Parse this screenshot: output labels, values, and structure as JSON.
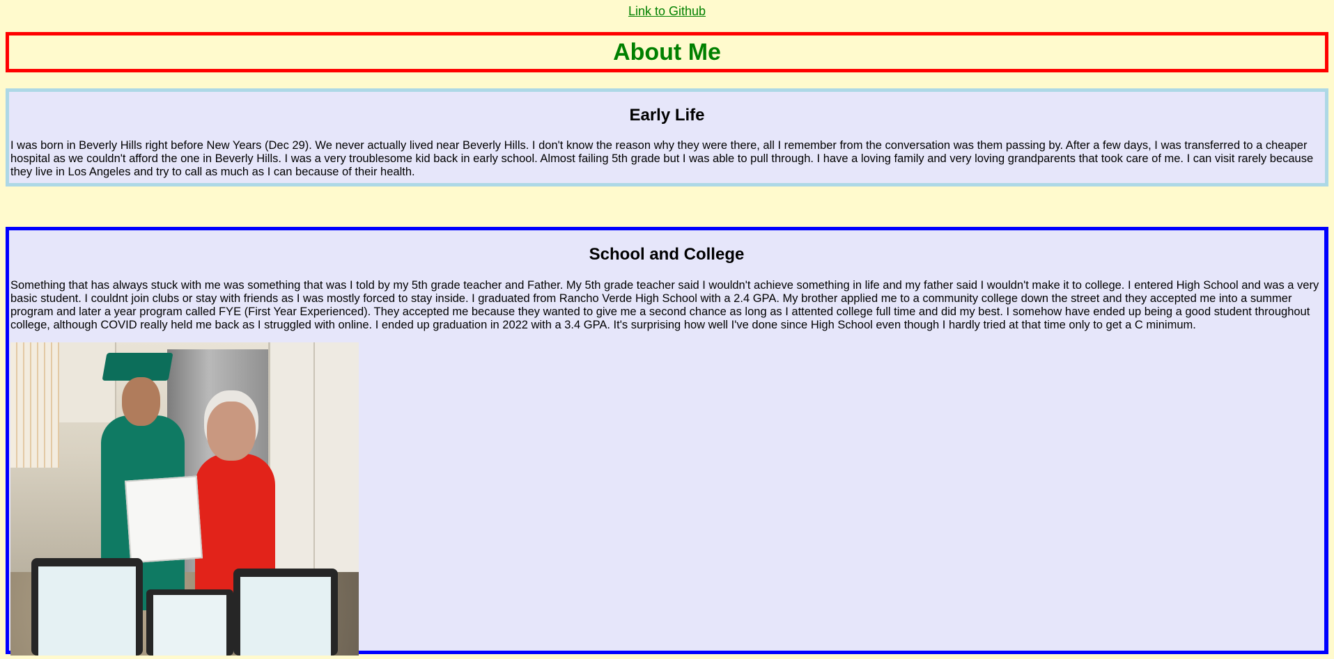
{
  "header": {
    "github_link": "Link to Github",
    "title": "About Me"
  },
  "early_life": {
    "heading": "Early Life",
    "text": "I was born in Beverly Hills right before New Years (Dec 29). We never actually lived near Beverly Hills. I don't know the reason why they were there, all I remember from the conversation was them passing by. After a few days, I was transferred to a cheaper hospital as we couldn't afford the one in Beverly Hills. I was a very troublesome kid back in early school. Almost failing 5th grade but I was able to pull through. I have a loving family and very loving grandparents that took care of me. I can visit rarely because they live in Los Angeles and try to call as much as I can because of their health."
  },
  "school": {
    "heading": "School and College",
    "text": "Something that has always stuck with me was something that was I told by my 5th grade teacher and Father. My 5th grade teacher said I wouldn't achieve something in life and my father said I wouldn't make it to college. I entered High School and was a very basic student. I couldnt join clubs or stay with friends as I was mostly forced to stay inside. I graduated from Rancho Verde High School with a 2.4 GPA. My brother applied me to a community college down the street and they accepted me into a summer program and later a year program called FYE (First Year Experienced). They accepted me because they wanted to give me a second chance as long as I attented college full time and did my best. I somehow have ended up being a good student throughout college, although COVID really held me back as I struggled with online. I ended up graduation in 2022 with a 3.4 GPA. It's surprising how well I've done since High School even though I hardly tried at that time only to get a C minimum."
  },
  "colors": {
    "background": "#fffacd",
    "section_background": "#e6e6fa",
    "link_and_title": "#008000",
    "title_border": "#ff0000",
    "early_life_border": "#add8e6",
    "school_border": "#0000ff"
  }
}
